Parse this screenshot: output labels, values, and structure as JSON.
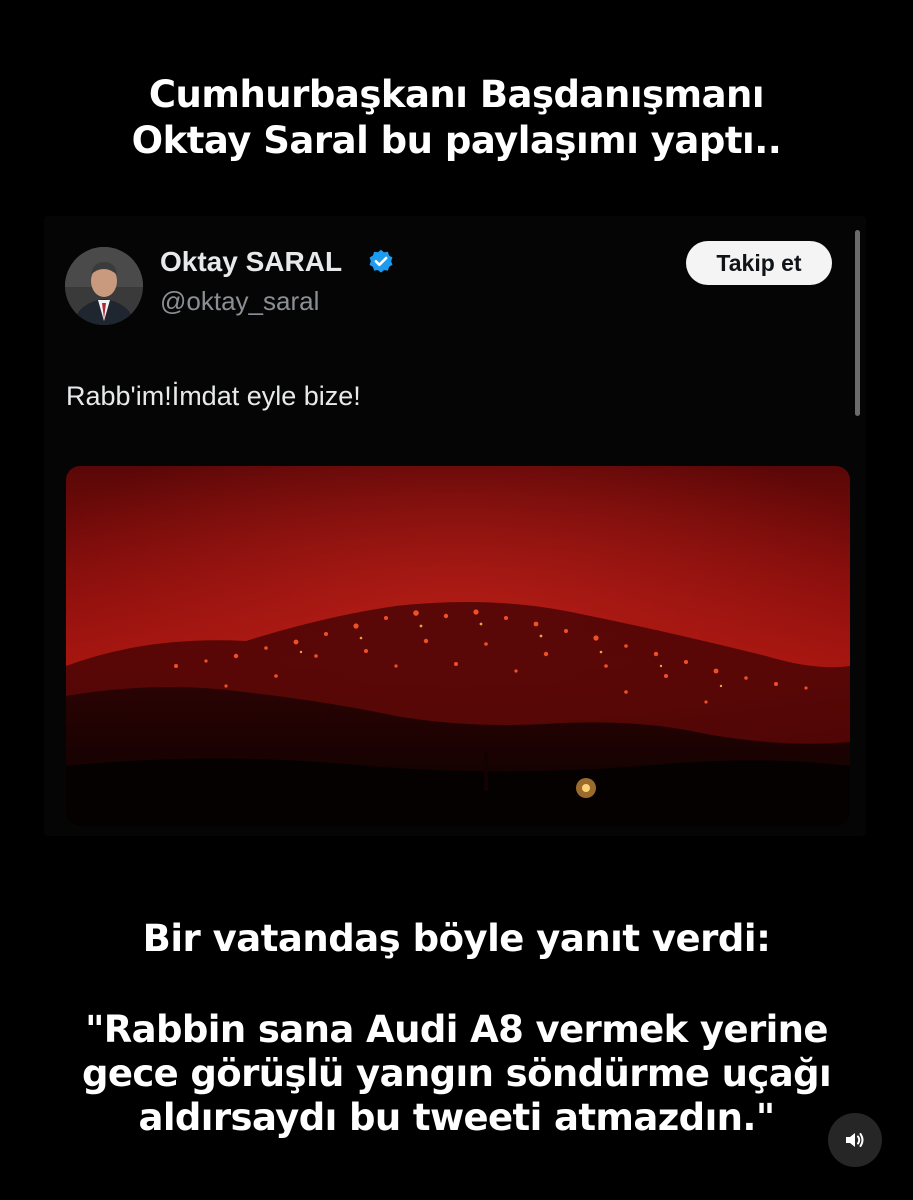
{
  "headline": {
    "line1": "Cumhurbaşkanı Başdanışmanı",
    "line2": "Oktay Saral bu paylaşımı yaptı.."
  },
  "tweet": {
    "author_name": "Oktay SARAL",
    "author_handle": "@oktay_saral",
    "follow_label": "Takip et",
    "text": "Rabb'im!İmdat eyle bize!",
    "verified_icon": "verified-badge-icon",
    "accent_color": "#1d9bf0"
  },
  "subhead": "Bir vatandaş böyle yanıt verdi:",
  "quote": {
    "line1": "\"Rabbin sana Audi A8 vermek yerine",
    "line2": "gece görüşlü yangın söndürme uçağı",
    "line3": "aldırsaydı bu tweeti atmazdın.\""
  },
  "controls": {
    "sound_icon": "speaker-icon"
  }
}
